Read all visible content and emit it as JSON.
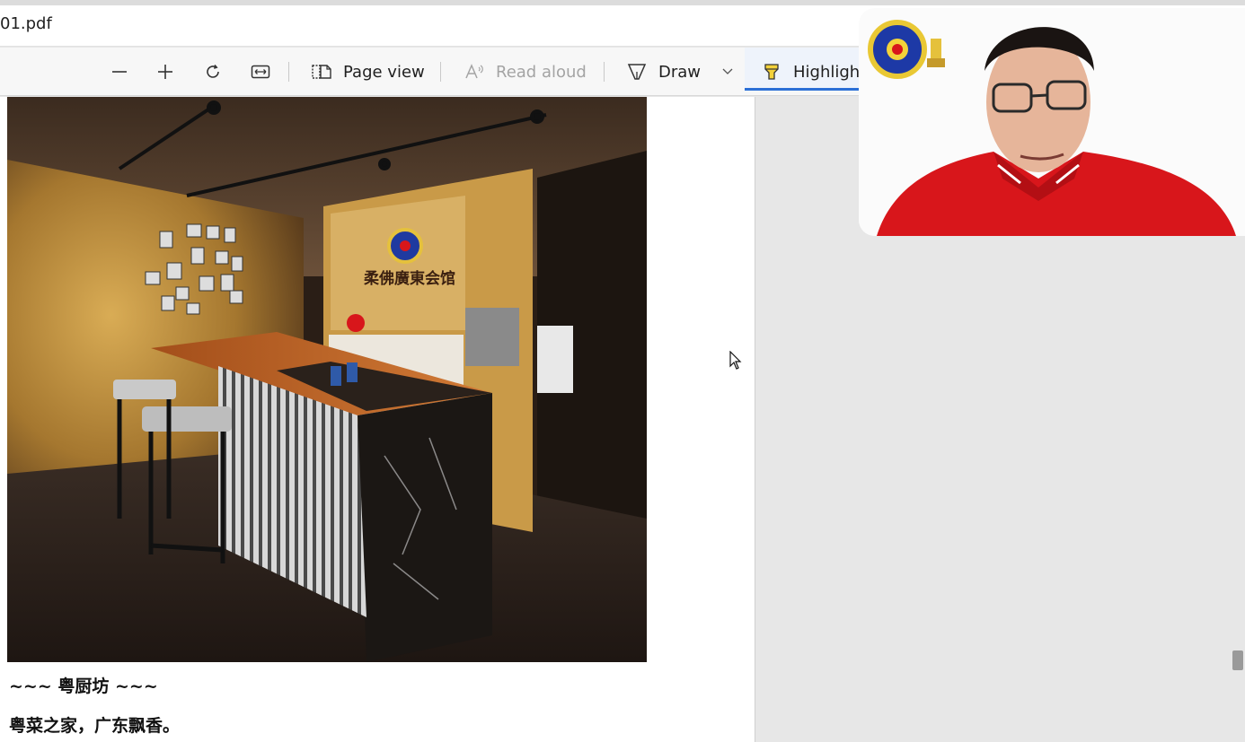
{
  "window": {
    "file_title": "01.pdf"
  },
  "toolbar": {
    "zoom_out_icon": "minus-icon",
    "zoom_in_icon": "plus-icon",
    "rotate_icon": "rotate-icon",
    "fit_icon": "fit-width-icon",
    "page_view_label": "Page view",
    "read_aloud_label": "Read aloud",
    "draw_label": "Draw",
    "highlight_label": "Highligh"
  },
  "document": {
    "line_1": "~~~ 粤厨坊 ~~~",
    "line_2": "粤菜之家，广东飘香。",
    "photo_sign": "柔佛廣東会馆"
  },
  "colors": {
    "accent": "#2b6fd6",
    "shirt_red": "#d8161b",
    "wood": "#c9973e"
  }
}
